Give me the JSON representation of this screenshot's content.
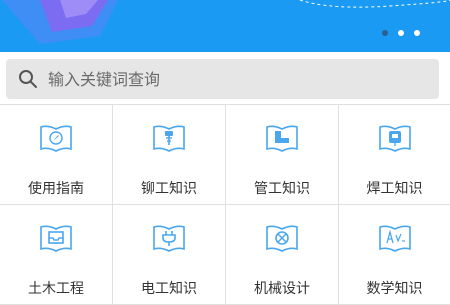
{
  "banner": {
    "carousel": {
      "count": 3,
      "active_index": 2
    },
    "colors": {
      "background": "#1a9af2",
      "accent": "#ffffff"
    }
  },
  "search": {
    "placeholder": "输入关键词查询",
    "icon": "search-icon"
  },
  "categories": [
    {
      "label": "使用指南",
      "icon": "compass-book-icon"
    },
    {
      "label": "铆工知识",
      "icon": "rivet-book-icon"
    },
    {
      "label": "管工知识",
      "icon": "pipe-book-icon"
    },
    {
      "label": "焊工知识",
      "icon": "welding-book-icon"
    },
    {
      "label": "土木工程",
      "icon": "tray-book-icon"
    },
    {
      "label": "电工知识",
      "icon": "plug-book-icon"
    },
    {
      "label": "机械设计",
      "icon": "gear-book-icon"
    },
    {
      "label": "数学知识",
      "icon": "formula-book-icon"
    }
  ],
  "colors": {
    "icon": "#4aa7ee",
    "text": "#333333",
    "divider": "#e0e0e0"
  }
}
